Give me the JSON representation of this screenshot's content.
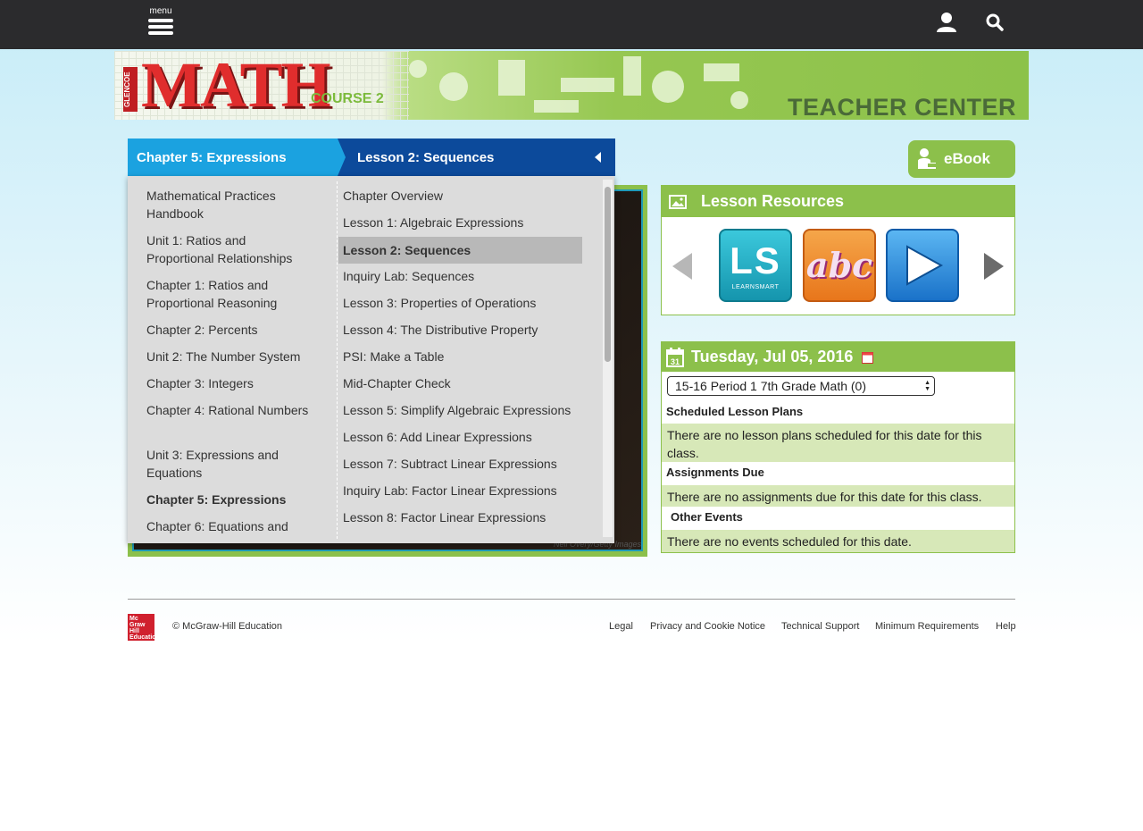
{
  "topbar": {
    "menu_label": "menu"
  },
  "banner": {
    "logo_text": "MATH",
    "logo_brand": "GLENCOE",
    "course": "COURSE 2",
    "teacher_center": "TEACHER CENTER"
  },
  "breadcrumb": {
    "chapter": "Chapter 5: Expressions",
    "lesson": "Lesson 2: Sequences"
  },
  "dropdown": {
    "left_items": [
      "Mathematical Practices Handbook",
      "Unit 1: Ratios and Proportional Relationships",
      "Chapter 1: Ratios and Proportional Reasoning",
      "Chapter 2: Percents",
      "Unit 2: The Number System",
      "Chapter 3: Integers",
      "Chapter 4: Rational Numbers",
      "Unit 3: Expressions and Equations",
      "Chapter 5: Expressions",
      "Chapter 6: Equations and"
    ],
    "right_items": [
      "Chapter Overview",
      "Lesson 1: Algebraic Expressions",
      "Lesson 2: Sequences",
      "Inquiry Lab: Sequences",
      "Lesson 3: Properties of Operations",
      "Lesson 4: The Distributive Property",
      "PSI: Make a Table",
      "Mid-Chapter Check",
      "Lesson 5: Simplify Algebraic Expressions",
      "Lesson 6: Add Linear Expressions",
      "Lesson 7: Subtract Linear Expressions",
      "Inquiry Lab: Factor Linear Expressions",
      "Lesson 8: Factor Linear Expressions"
    ]
  },
  "hero": {
    "credit": "Neil Overy/Getty Images"
  },
  "ebook": {
    "label": "eBook"
  },
  "resources": {
    "title": "Lesson Resources",
    "tiles": [
      {
        "name": "learnsmart",
        "big": "LS",
        "small": "LEARNSMART"
      },
      {
        "name": "vocabulary",
        "big": "abc"
      },
      {
        "name": "video",
        "icon": "play-icon"
      }
    ]
  },
  "calendar": {
    "date": "Tuesday, Jul 05, 2016",
    "class_select": "15-16 Period 1 7th Grade Math (0)",
    "scheduled_label": "Scheduled Lesson Plans",
    "scheduled_text": "There are no lesson plans scheduled for this date for this class.",
    "assignments_label": "Assignments Due",
    "assignments_text": "There are no assignments due for this date for this class.",
    "events_label": "Other Events",
    "events_text": "There are no events scheduled for this date."
  },
  "footer": {
    "logo_text": "Mc Graw Hill Education",
    "copyright": "© McGraw-Hill Education",
    "links": [
      "Legal",
      "Privacy and Cookie Notice",
      "Technical Support",
      "Minimum Requirements",
      "Help"
    ]
  },
  "colors": {
    "topbar": "#2b2b2d",
    "accent_green": "#8cc04b",
    "chapter_blue": "#1ba2e0",
    "lesson_blue": "#0c4a9b",
    "brand_red": "#d0202e"
  }
}
